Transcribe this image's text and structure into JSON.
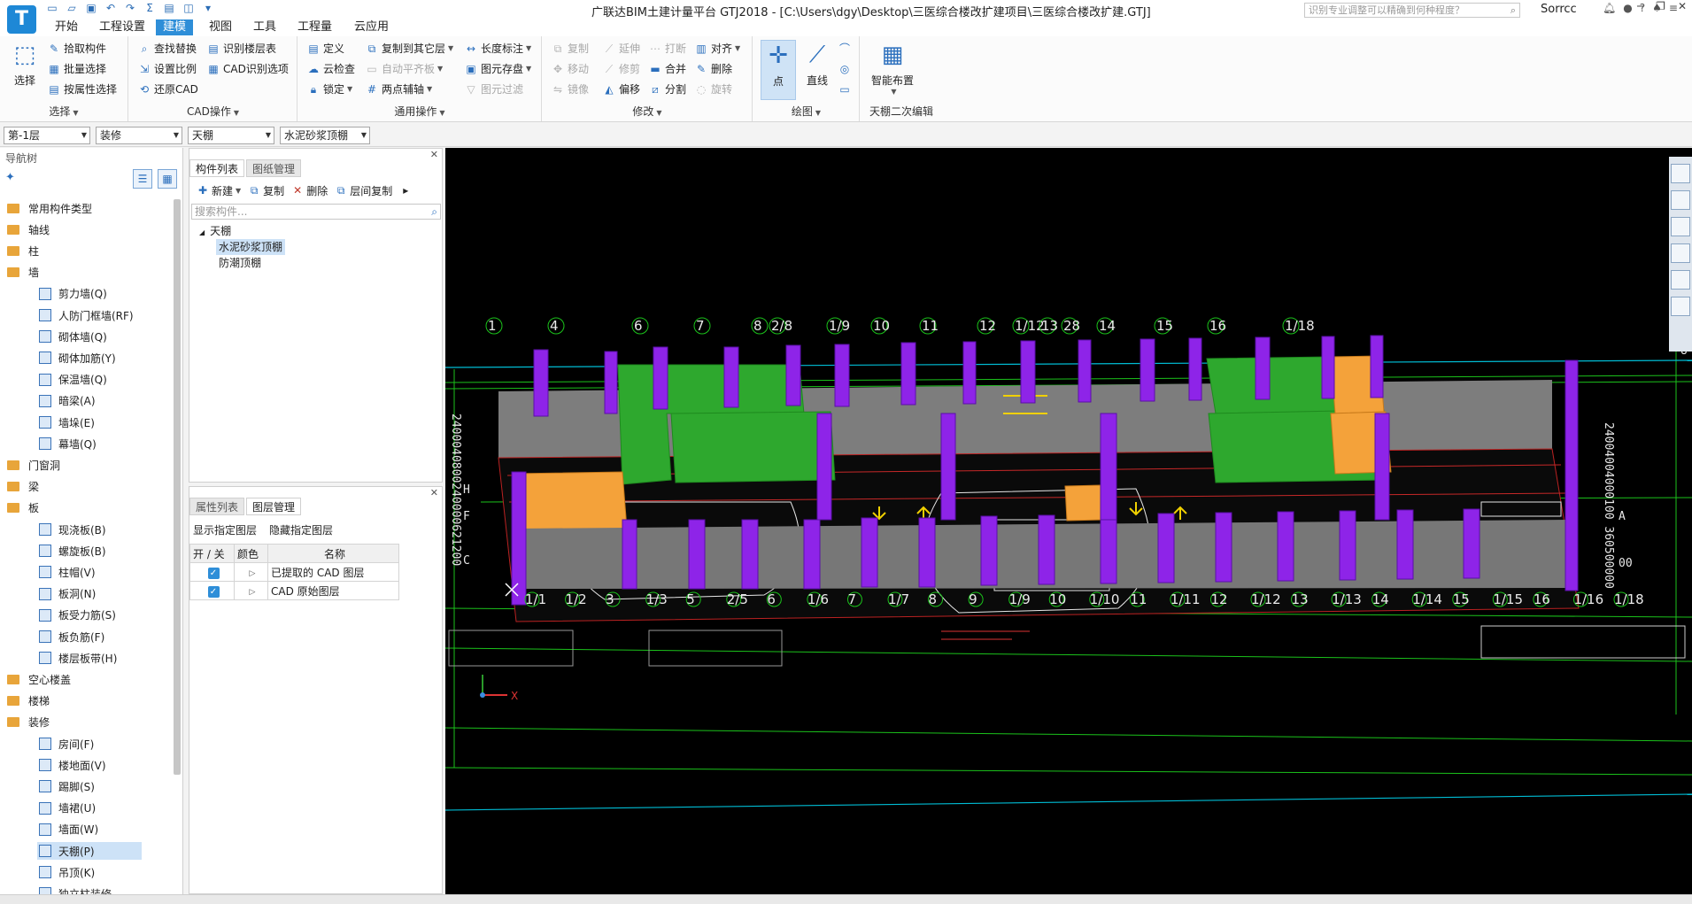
{
  "titlebar": {
    "app_title": "广联达BIM土建计量平台 GTJ2018 - [C:\\Users\\dgy\\Desktop\\三医综合楼改扩建项目\\三医综合楼改扩建.GTJ]",
    "help_search_placeholder": "识别专业调整可以精确到何种程度？",
    "user_name": "Sorrcc"
  },
  "menu_tabs": [
    "开始",
    "工程设置",
    "建模",
    "视图",
    "工具",
    "工程量",
    "云应用"
  ],
  "ribbon": {
    "select_group": {
      "label": "选择",
      "big": "选择",
      "items": [
        "拾取构件",
        "批量选择",
        "按属性选择"
      ]
    },
    "cad_group": {
      "label": "CAD操作",
      "items": [
        "查找替换",
        "识别楼层表",
        "设置比例",
        "CAD识别选项",
        "还原CAD"
      ]
    },
    "common_group": {
      "label": "通用操作",
      "items": [
        "定义",
        "复制到其它层",
        "长度标注",
        "云检查",
        "自动平齐板",
        "图元存盘",
        "锁定",
        "两点辅轴",
        "图元过滤"
      ]
    },
    "modify_group": {
      "label": "修改",
      "items": [
        "复制",
        "延伸",
        "打断",
        "对齐",
        "移动",
        "修剪",
        "合并",
        "删除",
        "镜像",
        "偏移",
        "分割",
        "旋转"
      ]
    },
    "draw_group": {
      "label": "绘图",
      "point": "点",
      "line": "直线"
    },
    "ceiling_group": {
      "label": "天棚二次编辑",
      "big": "智能布置"
    }
  },
  "selectors": {
    "floor": "第-1层",
    "category": "装修",
    "type": "天棚",
    "component": "水泥砂浆顶棚"
  },
  "nav": {
    "title": "导航树",
    "tree": [
      {
        "cat": "常用构件类型"
      },
      {
        "cat": "轴线"
      },
      {
        "cat": "柱"
      },
      {
        "cat": "墙",
        "items": [
          "剪力墙(Q)",
          "人防门框墙(RF)",
          "砌体墙(Q)",
          "砌体加筋(Y)",
          "保温墙(Q)",
          "暗梁(A)",
          "墙垛(E)",
          "幕墙(Q)"
        ]
      },
      {
        "cat": "门窗洞"
      },
      {
        "cat": "梁"
      },
      {
        "cat": "板",
        "items": [
          "现浇板(B)",
          "螺旋板(B)",
          "柱帽(V)",
          "板洞(N)",
          "板受力筋(S)",
          "板负筋(F)",
          "楼层板带(H)"
        ]
      },
      {
        "cat": "空心楼盖"
      },
      {
        "cat": "楼梯"
      },
      {
        "cat": "装修",
        "items": [
          "房间(F)",
          "楼地面(V)",
          "踢脚(S)",
          "墙裙(U)",
          "墙面(W)",
          "天棚(P)",
          "吊顶(K)",
          "独立柱装修"
        ]
      }
    ],
    "selected": "天棚(P)"
  },
  "component_panel": {
    "tabs": [
      "构件列表",
      "图纸管理"
    ],
    "toolbar": [
      "新建",
      "复制",
      "删除",
      "层间复制"
    ],
    "search_placeholder": "搜索构件...",
    "root": "天棚",
    "children": [
      "水泥砂浆顶棚",
      "防潮顶棚"
    ],
    "selected": "水泥砂浆顶棚"
  },
  "layer_panel": {
    "tabs": [
      "属性列表",
      "图层管理"
    ],
    "actions": [
      "显示指定图层",
      "隐藏指定图层"
    ],
    "headers": [
      "开 / 关",
      "颜色",
      "名称"
    ],
    "rows": [
      {
        "name": "已提取的 CAD 图层",
        "on": true
      },
      {
        "name": "CAD 原始图层",
        "on": true
      }
    ]
  },
  "viewport": {
    "top_axis": [
      "1",
      "4",
      "6",
      "7",
      "8",
      "2/8",
      "1/9",
      "10",
      "11",
      "12",
      "1/12",
      "13",
      "28",
      "14",
      "15",
      "16",
      "1/18"
    ],
    "bottom_axis": [
      "1/1",
      "1/2",
      "3",
      "1/3",
      "5",
      "2/5",
      "6",
      "1/6",
      "7",
      "1/7",
      "8",
      "9",
      "1/9",
      "10",
      "1/10",
      "11",
      "1/11",
      "12",
      "1/12",
      "13",
      "1/13",
      "14",
      "1/14",
      "15",
      "1/15",
      "16",
      "1/16",
      "1/18"
    ],
    "left_axis": [
      "H",
      "F",
      "C"
    ],
    "right_axis": [
      "U",
      "A",
      "00"
    ],
    "axis_x_label": "X"
  }
}
